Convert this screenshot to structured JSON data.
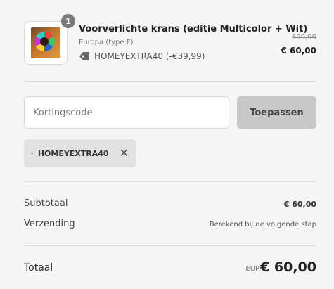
{
  "line_item": {
    "quantity": "1",
    "title": "Voorverlichte krans (editie Multicolor + Wit)",
    "variant": "Europa (type F)",
    "discount": "HOMEYEXTRA40 (-€39,99)",
    "original_price": "€99,99",
    "final_price": "€ 60,00",
    "image_icon": "product-box-image"
  },
  "discount_form": {
    "placeholder": "Kortingscode",
    "value": "",
    "apply_label": "Toepassen"
  },
  "applied_code": {
    "code": "HOMEYEXTRA40",
    "icon": "tag-icon",
    "remove_icon": "close-icon"
  },
  "summary": {
    "subtotal_label": "Subtotaal",
    "subtotal_value": "€ 60,00",
    "shipping_label": "Verzending",
    "shipping_value": "Berekend bij de volgende stap",
    "total_label": "Totaal",
    "total_currency": "EUR",
    "total_value": "€ 60,00"
  },
  "colors": {
    "background": "#f5f5f5",
    "button": "#c8c8c8",
    "chip": "#e1e1e1",
    "badge": "#7a7a7a"
  }
}
